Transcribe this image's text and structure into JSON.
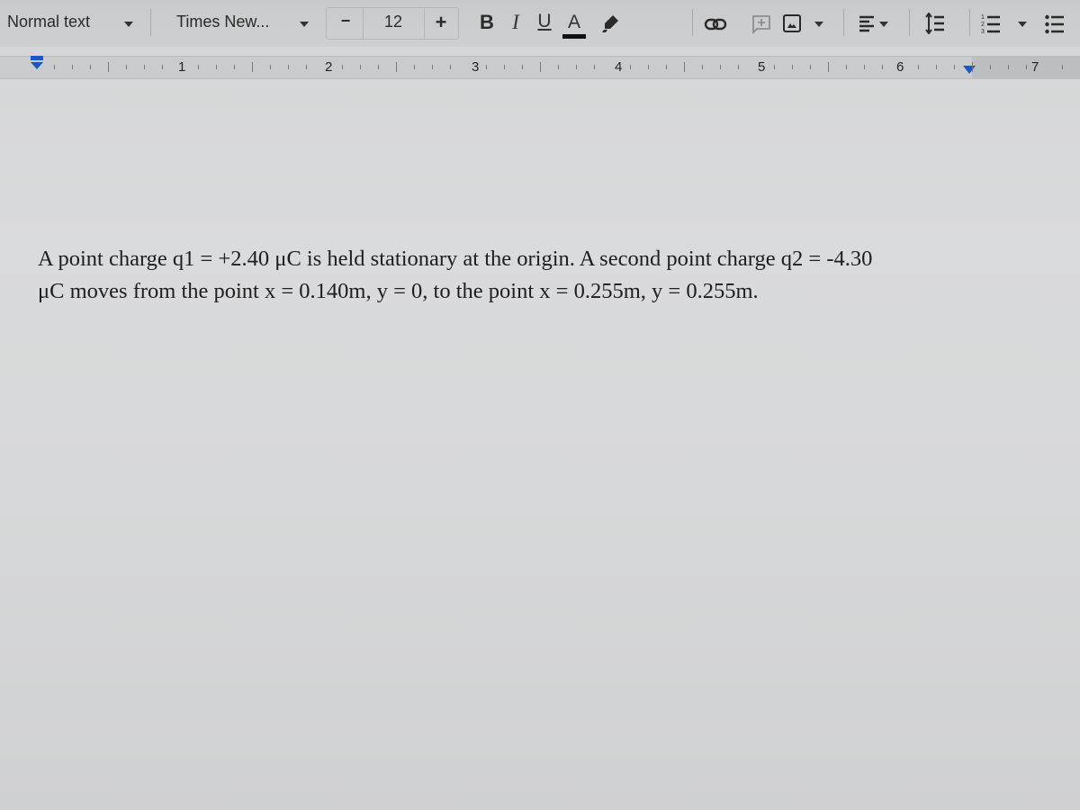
{
  "toolbar": {
    "paragraph_style": "Normal text",
    "font_family": "Times New...",
    "font_size": "12",
    "decrease_label": "−",
    "increase_label": "+",
    "bold_label": "B",
    "italic_label": "I",
    "underline_label": "U",
    "text_color_label": "A",
    "text_color": "#111111",
    "icons": [
      "highlight-icon",
      "link-icon",
      "add-comment-icon",
      "insert-image-icon",
      "align-left-icon",
      "line-spacing-icon",
      "numbered-list-icon",
      "bulleted-list-icon"
    ]
  },
  "ruler": {
    "numbers": [
      "1",
      "2",
      "3",
      "4",
      "5",
      "6",
      "7"
    ],
    "indent_marker_color": "#1a57c8"
  },
  "document": {
    "lines": [
      "A point charge  q1 = +2.40 μC is held stationary at the origin. A second point charge q2 = -4.30",
      "μC moves from the point x = 0.140m, y = 0, to the point x = 0.255m, y = 0.255m."
    ]
  }
}
